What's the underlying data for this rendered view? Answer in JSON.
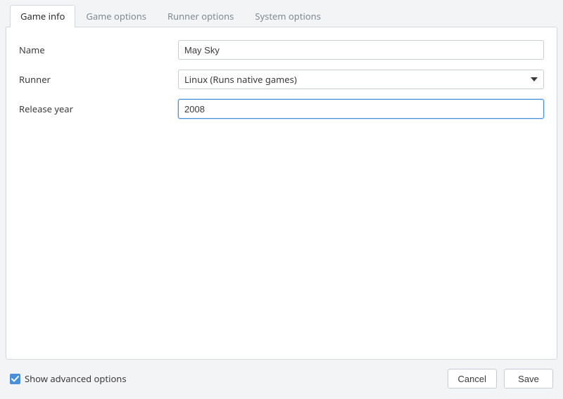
{
  "tabs": [
    {
      "label": "Game info",
      "active": true
    },
    {
      "label": "Game options",
      "active": false
    },
    {
      "label": "Runner options",
      "active": false
    },
    {
      "label": "System options",
      "active": false
    }
  ],
  "form": {
    "name_label": "Name",
    "name_value": "May Sky",
    "runner_label": "Runner",
    "runner_value": "Linux (Runs native games)",
    "release_year_label": "Release year",
    "release_year_value": "2008"
  },
  "footer": {
    "show_advanced_label": "Show advanced options",
    "show_advanced_checked": true,
    "cancel_label": "Cancel",
    "save_label": "Save"
  }
}
